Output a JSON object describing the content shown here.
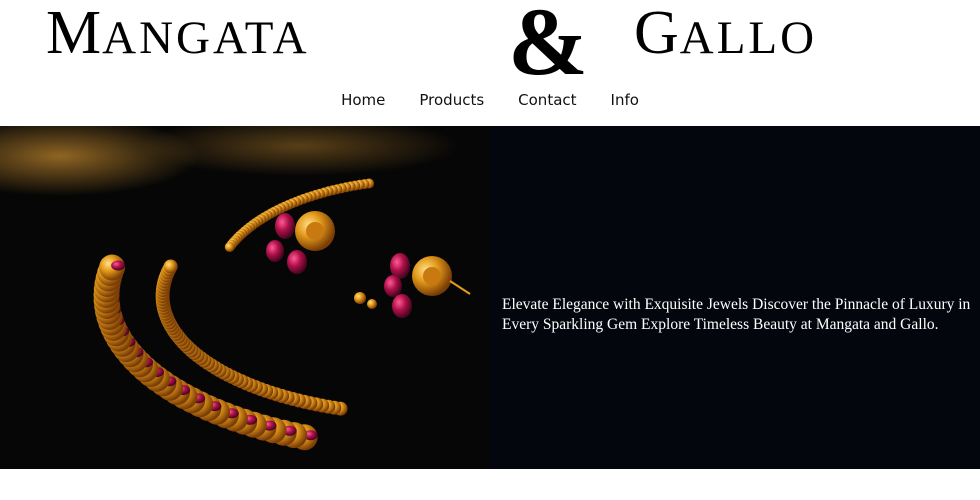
{
  "brand": {
    "left_initial": "M",
    "left_rest": "ANGATA",
    "ampersand": "&",
    "right_initial": "G",
    "right_rest": "ALLO"
  },
  "nav": {
    "items": [
      "Home",
      "Products",
      "Contact",
      "Info"
    ]
  },
  "hero": {
    "tagline": "Elevate Elegance with Exquisite Jewels Discover the Pinnacle of Luxury in Every Sparkling Gem Explore Timeless Beauty at Mangata and Gallo."
  },
  "colors": {
    "hero_background": "#03070d",
    "gold": "#e49a1c",
    "ruby": "#b0104a"
  }
}
